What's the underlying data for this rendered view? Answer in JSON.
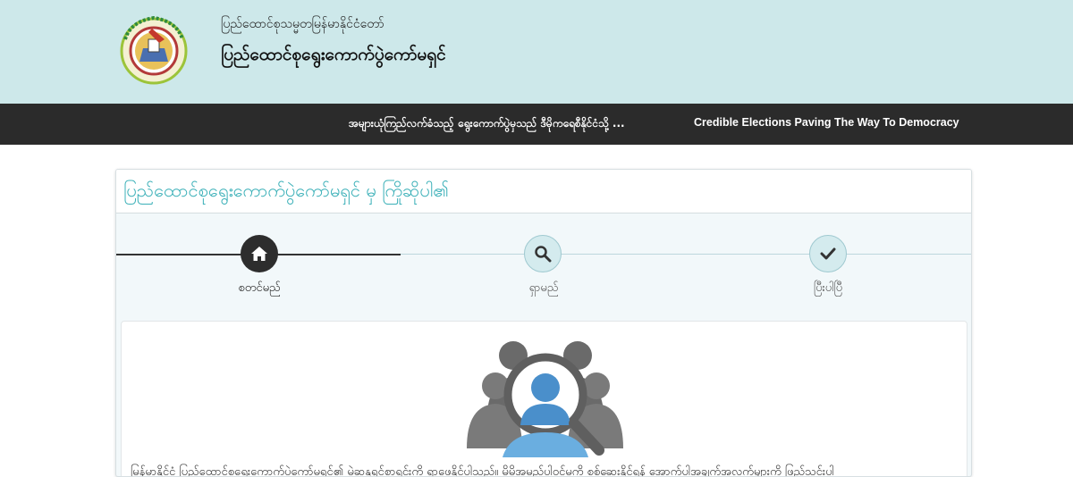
{
  "header": {
    "subtitle": "ပြည်ထောင်စုသမ္မတမြန်မာနိုင်ငံတော်",
    "title": "ပြည်ထောင်စုရွေးကောက်ပွဲကော်မရှင်",
    "logo_icon": "election-commission-seal-icon"
  },
  "nav": {
    "slogan_mm": "အများယုံကြည်လက်ခံသည့် ရွေးကောက်ပွဲမှသည် ဒီမိုကရေစီနိုင်ငံသို့ ...",
    "slogan_en": "Credible Elections Paving The Way To Democracy"
  },
  "panel": {
    "title": "ပြည်ထောင်စုရွေးကောက်ပွဲကော်မရှင် မှ ကြိုဆိုပါ၏"
  },
  "steps": [
    {
      "label": "စတင်မည်",
      "icon": "home-icon",
      "active": true
    },
    {
      "label": "ရှာမည်",
      "icon": "search-icon",
      "active": false
    },
    {
      "label": "ပြီးပါပြီ",
      "icon": "check-icon",
      "active": false
    }
  ],
  "content": {
    "illustration_icon": "voter-search-magnifier-icon",
    "intro_text": "မြန်မာနိုင်ငံ ပြည်ထောင်စုရွေးကောက်ပွဲကော်မရှင်၏ မဲဆန္ဒရှင်စာရင်းကို ရှာဖွေနိုင်ပါသည်။ မိမိအမည်ပါဝင်မှုကို စစ်ဆေးနိုင်ရန် အောက်ပါအချက်အလက်များကို ဖြည့်သွင်းပါ"
  },
  "colors": {
    "header_bg": "#cde8ea",
    "nav_bg": "#2b2b2b",
    "accent_teal": "#3bb0b8",
    "step_active": "#2d2d2d"
  }
}
